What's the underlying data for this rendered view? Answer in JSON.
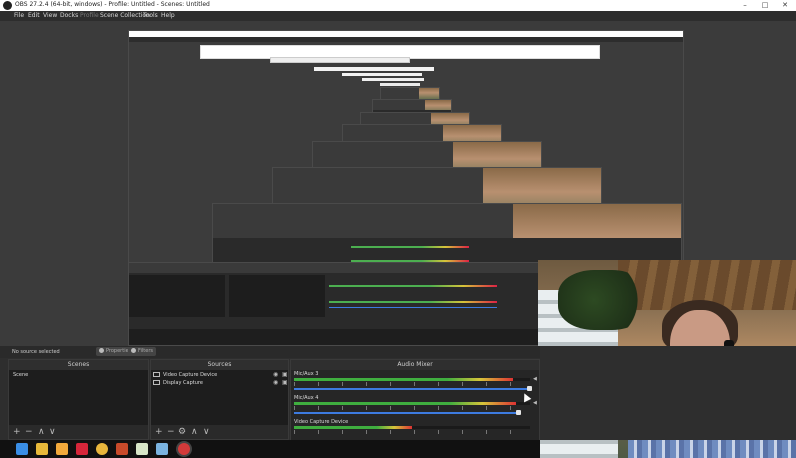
{
  "window": {
    "title": "OBS 27.2.4 (64-bit, windows) - Profile: Untitled - Scenes: Untitled",
    "minimize": "–",
    "maximize": "□",
    "close": "✕"
  },
  "menu": [
    "File",
    "Edit",
    "View",
    "Docks",
    "Profile",
    "Scene Collection",
    "Tools",
    "Help"
  ],
  "context_bar": {
    "status": "No source selected",
    "properties_label": "Properties",
    "filters_label": "Filters"
  },
  "scenes": {
    "header": "Scenes",
    "items": [
      "Scene"
    ],
    "footer_buttons": [
      "+",
      "−",
      "∧",
      "∨"
    ]
  },
  "sources": {
    "header": "Sources",
    "items": [
      {
        "name": "Video Capture Device",
        "icon": "camera-icon"
      },
      {
        "name": "Display Capture",
        "icon": "monitor-icon"
      }
    ],
    "footer_buttons": [
      "+",
      "−",
      "⚙",
      "∧",
      "∨"
    ]
  },
  "mixer": {
    "header": "Audio Mixer",
    "tracks": [
      {
        "name": "Mic/Aux 3",
        "level": 0.93,
        "volume": 1.0
      },
      {
        "name": "Mic/Aux 4",
        "level": 0.94,
        "volume": 0.95
      },
      {
        "name": "Video Capture Device",
        "level": 0.5,
        "volume": 1.0
      }
    ]
  },
  "taskbar": {
    "icons": [
      {
        "name": "windows-start-icon",
        "color": "#3a8ee6"
      },
      {
        "name": "file-explorer-icon",
        "color": "#e8b93a"
      },
      {
        "name": "pen-app-icon",
        "color": "#f2a93b"
      },
      {
        "name": "red-app-icon",
        "color": "#d6263a"
      },
      {
        "name": "chrome-icon",
        "color": "#e9b63c"
      },
      {
        "name": "feather-app-icon",
        "color": "#c84a2a"
      },
      {
        "name": "notepad-icon",
        "color": "#d8e6c8"
      },
      {
        "name": "blue-app-icon",
        "color": "#7ab3e0"
      },
      {
        "name": "obs-icon",
        "color": "#d33a3a"
      }
    ]
  }
}
